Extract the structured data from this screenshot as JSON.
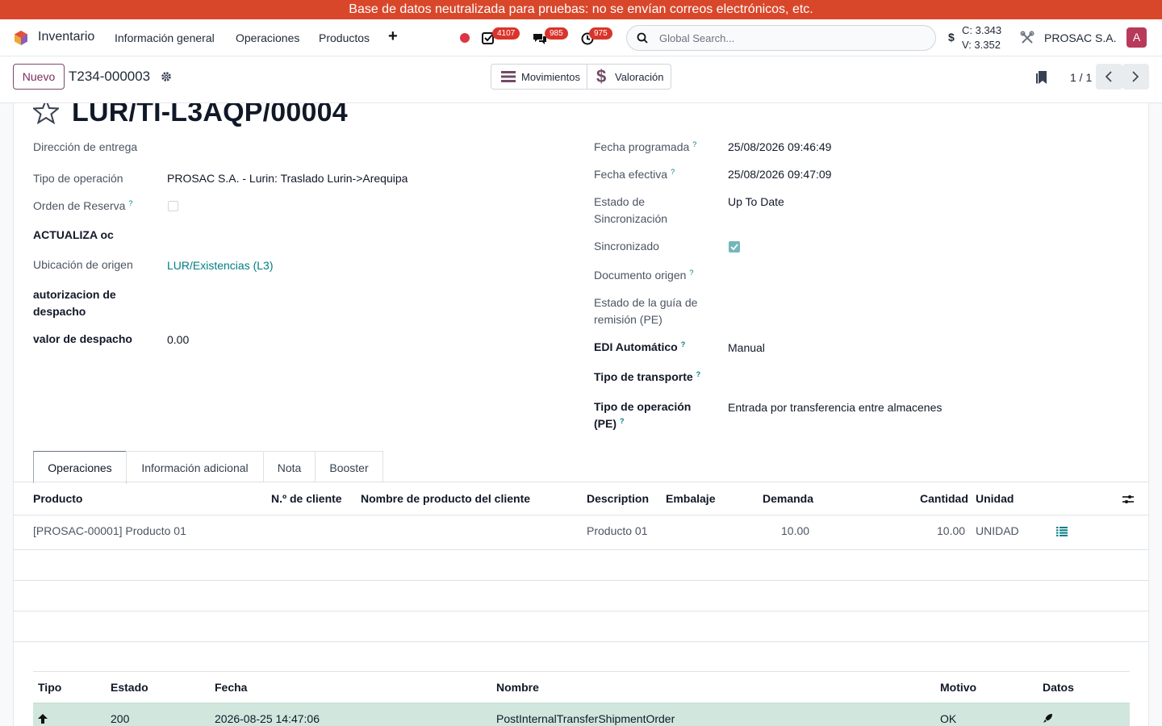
{
  "banner": {
    "text": "Base de datos neutralizada para pruebas: no se envían correos electrónicos, etc."
  },
  "navbar": {
    "app_name": "Inventario",
    "menu": [
      "Información general",
      "Operaciones",
      "Productos"
    ],
    "activities_count": "4107",
    "messages_count": "985",
    "clock_count": "975",
    "search_placeholder": "Global Search...",
    "currency_symbol": "$",
    "rate_buy": "C: 3.343",
    "rate_sell": "V: 3.352",
    "company": "PROSAC S.A.",
    "avatar_letter": "A",
    "accent": "#d9472b"
  },
  "control": {
    "new_label": "Nuevo",
    "record_ref": "T234-000003",
    "smart_buttons": [
      "Movimientos",
      "Valoración"
    ],
    "pager": "1 / 1"
  },
  "form": {
    "title": "LUR/TI-L3AQP/00004",
    "left": [
      {
        "label": "Dirección de entrega",
        "value": ""
      },
      {
        "label": "Tipo de operación",
        "value": "PROSAC S.A. - Lurin: Traslado Lurin->Arequipa"
      },
      {
        "label": "Orden de Reserva",
        "value": ""
      },
      {
        "label": "ACTUALIZA oc",
        "value": ""
      },
      {
        "label": "Ubicación de origen",
        "value": "LUR/Existencias (L3)"
      },
      {
        "label": "autorizacion de despacho",
        "value": ""
      },
      {
        "label": "valor de despacho",
        "value": "0.00"
      }
    ],
    "right": [
      {
        "label": "Fecha programada",
        "value": "25/08/2026 09:46:49"
      },
      {
        "label": "Fecha efectiva",
        "value": "25/08/2026 09:47:09"
      },
      {
        "label": "Estado de Sincronización",
        "value": "Up To Date"
      },
      {
        "label": "Sincronizado",
        "value": ""
      },
      {
        "label": "Documento origen",
        "value": ""
      },
      {
        "label": "Estado de la guía de remisión (PE)",
        "value": ""
      },
      {
        "label": "EDI Automático",
        "value": "Manual"
      },
      {
        "label": "Tipo de transporte",
        "value": ""
      },
      {
        "label": "Tipo de operación (PE)",
        "value": "Entrada por transferencia entre almacenes"
      }
    ],
    "help_mark": "?"
  },
  "tabs": [
    "Operaciones",
    "Información adicional",
    "Nota",
    "Booster"
  ],
  "product_table": {
    "headers": [
      "Producto",
      "N.º de cliente",
      "Nombre de producto del cliente",
      "Description",
      "Embalaje",
      "Demanda",
      "Cantidad",
      "Unidad"
    ],
    "rows": [
      {
        "product": "[PROSAC-00001] Producto 01",
        "description": "Producto 01",
        "demand": "10.00",
        "quantity": "10.00",
        "unit": "UNIDAD"
      }
    ]
  },
  "log_table": {
    "headers": [
      "Tipo",
      "Estado",
      "Fecha",
      "Nombre",
      "Motivo",
      "Datos"
    ],
    "rows": [
      {
        "status": "200",
        "date": "2026-08-25 14:47:06",
        "name": "PostInternalTransferShipmentOrder",
        "reason": "OK"
      }
    ]
  }
}
